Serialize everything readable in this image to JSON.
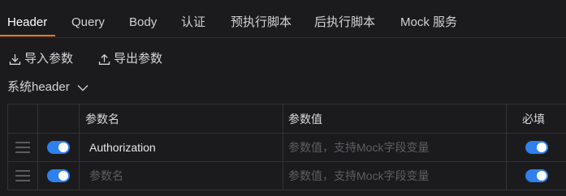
{
  "tabs": [
    {
      "label": "Header",
      "active": true
    },
    {
      "label": "Query",
      "active": false
    },
    {
      "label": "Body",
      "active": false
    },
    {
      "label": "认证",
      "active": false
    },
    {
      "label": "预执行脚本",
      "active": false
    },
    {
      "label": "后执行脚本",
      "active": false
    },
    {
      "label": "Mock 服务",
      "active": false
    }
  ],
  "actions": {
    "import_label": "导入参数",
    "export_label": "导出参数"
  },
  "section": {
    "label": "系统header"
  },
  "table": {
    "columns": {
      "name": "参数名",
      "value": "参数值",
      "required": "必填"
    },
    "rows": [
      {
        "enabled": true,
        "name": "Authorization",
        "value_placeholder": "参数值，支持Mock字段变量",
        "required": true
      },
      {
        "enabled": true,
        "name_placeholder": "参数名",
        "value_placeholder": "参数值，支持Mock字段变量",
        "required": true
      }
    ]
  },
  "colors": {
    "accent": "#ff7a21",
    "toggle_on": "#2f80ed",
    "background": "#1b1b1d"
  },
  "icons": {
    "import": "download-icon",
    "export": "upload-icon",
    "expand": "chevron-down-icon",
    "drag": "drag-handle-icon"
  }
}
